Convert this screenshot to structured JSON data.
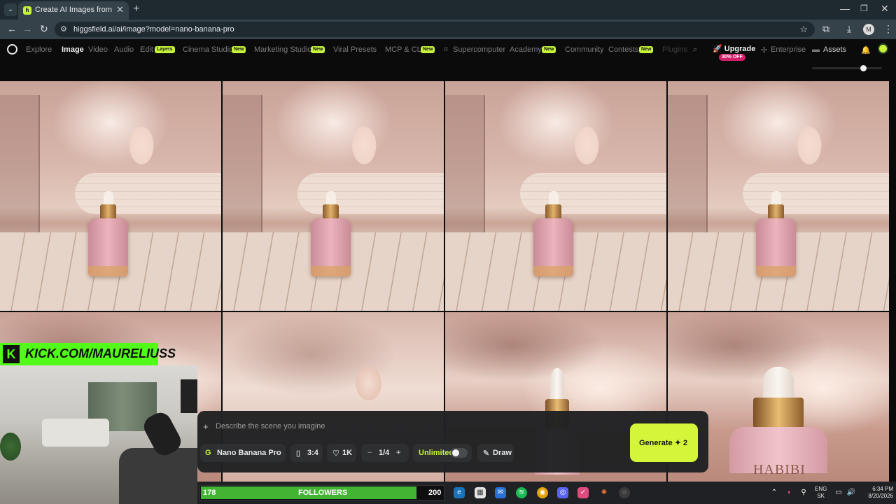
{
  "browser": {
    "tab_title": "Create AI Images from Text & P",
    "url": "higgsfield.ai/ai/image?model=nano-banana-pro",
    "profile_initial": "M"
  },
  "nav": {
    "items": [
      "Explore",
      "Image",
      "Video",
      "Audio",
      "Edit",
      "Cinema Studio",
      "Marketing Studio",
      "Viral Presets",
      "MCP & CLI",
      "Supercomputer",
      "Academy",
      "Community",
      "Contests",
      "Plugins"
    ],
    "active": "Image",
    "badge_layers": "Layers",
    "badge_new": "New",
    "upgrade_label": "Upgrade",
    "upgrade_badge": "30% OFF",
    "enterprise_label": "Enterprise",
    "assets_label": "Assets"
  },
  "gallery": {
    "row1_count": 4,
    "row2_count": 4,
    "bottle_label": "HABIBI"
  },
  "prompt": {
    "placeholder": "Describe the scene you imagine",
    "model": "Nano Banana Pro",
    "aspect_ratio": "3:4",
    "quality": "1K",
    "batch": "1/4",
    "unlimited_label": "Unlimited",
    "unlimited_on": false,
    "draw_label": "Draw",
    "generate_label": "Generate",
    "generate_cost": "2"
  },
  "stream": {
    "kick_banner": "KICK.COM/MAURELIUSS",
    "followers_count": "178",
    "followers_label": "FOLLOWERS",
    "followers_goal": "200",
    "followers_progress": 0.89
  },
  "taskbar": {
    "lang": "ENG",
    "region": "SK",
    "time": "6:34 PM",
    "date": "8/20/2026"
  },
  "colors": {
    "accent": "#d4f53a",
    "badge_new": "#c7f33a",
    "discount": "#d21f6a",
    "kick_green": "#53fc18"
  }
}
